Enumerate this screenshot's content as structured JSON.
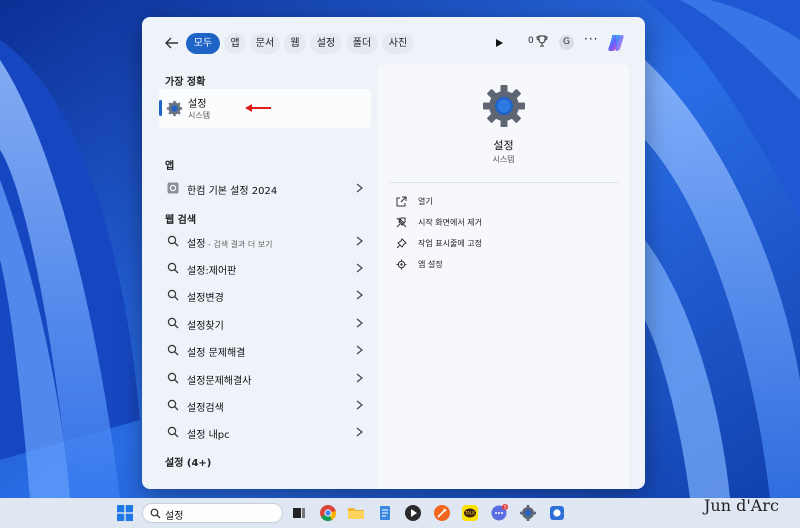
{
  "filters": [
    "모두",
    "앱",
    "문서",
    "웹",
    "설정",
    "폴더",
    "사진"
  ],
  "reward_count": "0",
  "avatar_letter": "G",
  "more": "···",
  "best_match": {
    "heading": "가장 정확",
    "title": "설정",
    "subtitle": "시스템"
  },
  "apps": {
    "heading": "앱",
    "items": [
      {
        "label": "한컴 기본 설정 2024"
      }
    ]
  },
  "web": {
    "heading": "웹 검색",
    "items": [
      {
        "label": "설정",
        "suffix": " - 검색 결과 더 보기"
      },
      {
        "label": "설정:제어판",
        "suffix": ""
      },
      {
        "label": "설정변경",
        "suffix": ""
      },
      {
        "label": "설정찾기",
        "suffix": ""
      },
      {
        "label": "설정 문제해결",
        "suffix": ""
      },
      {
        "label": "설정문제해결사",
        "suffix": ""
      },
      {
        "label": "설정검색",
        "suffix": ""
      },
      {
        "label": "설정 내pc",
        "suffix": ""
      }
    ]
  },
  "more_settings": "설정 (4+)",
  "detail": {
    "title": "설정",
    "subtitle": "시스템",
    "actions": [
      {
        "label": "열기",
        "icon": "open-external-icon"
      },
      {
        "label": "시작 화면에서 제거",
        "icon": "unpin-icon"
      },
      {
        "label": "작업 표시줄에 고정",
        "icon": "pin-icon"
      },
      {
        "label": "앱 설정",
        "icon": "gear-icon"
      }
    ]
  },
  "taskbar": {
    "search_value": "설정",
    "apps": [
      "task-view-icon",
      "chrome-icon",
      "file-explorer-icon",
      "notepad-icon",
      "media-player-icon",
      "pen-icon",
      "kakaotalk-icon",
      "chat-icon",
      "settings-icon",
      "app-icon"
    ],
    "chat_badge": "5",
    "kakaotalk_text": "TALK"
  },
  "watermark": "Jun d'Arc",
  "colors": {
    "accent": "#1e63c6",
    "arrow": "#e21b1b",
    "wallpaper": "#1d5fd6"
  }
}
